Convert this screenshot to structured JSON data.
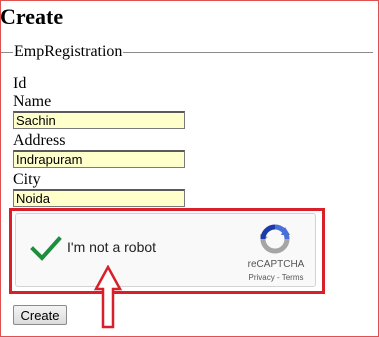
{
  "page": {
    "title": "Create"
  },
  "form": {
    "legend": "EmpRegistration",
    "fields": [
      {
        "label": "Id"
      },
      {
        "label": "Name",
        "value": "Sachin"
      },
      {
        "label": "Address",
        "value": "Indrapuram"
      },
      {
        "label": "City",
        "value": "Noida"
      }
    ],
    "submit_label": "Create"
  },
  "recaptcha": {
    "checked": true,
    "label": "I'm not a robot",
    "brand": "reCAPTCHA",
    "privacy_link": "Privacy",
    "separator": " - ",
    "terms_link": "Terms",
    "check_icon": "checkmark-icon",
    "logo_icon": "recaptcha-logo-icon"
  },
  "annotation": {
    "highlight_color": "#d9202a",
    "pointer_icon": "up-arrow-icon"
  },
  "colors": {
    "input_background": "#ffffcc",
    "check_green": "#1e8e3e",
    "frame_border": "#e05050"
  }
}
